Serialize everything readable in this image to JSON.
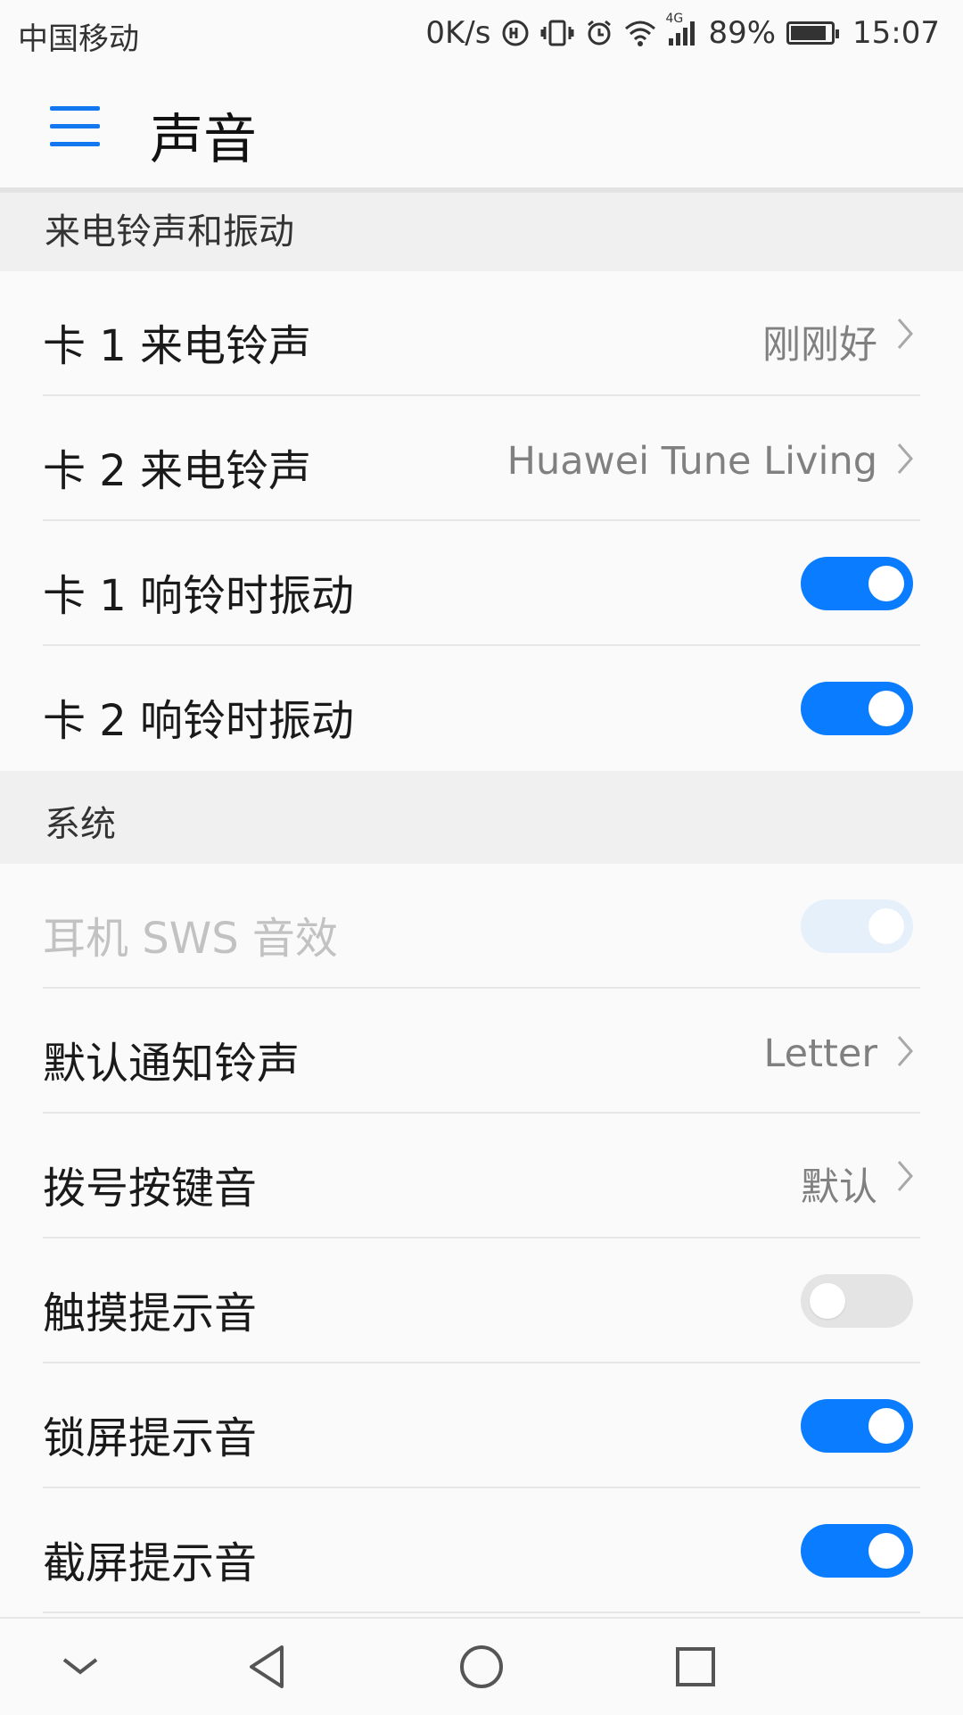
{
  "status_bar": {
    "carrier": "中国移动",
    "speed": "0K/s",
    "network": "4G",
    "battery_percent": "89%",
    "battery_level": 0.89,
    "time": "15:07",
    "icons": [
      "hd-call-icon",
      "vibrate-icon",
      "alarm-icon",
      "wifi-icon",
      "signal-icon",
      "battery-icon"
    ]
  },
  "app_bar": {
    "menu_icon": "menu-icon",
    "title": "声音"
  },
  "sections": {
    "incoming": {
      "title": "来电铃声和振动",
      "rows": [
        {
          "label": "卡 1 来电铃声",
          "value": "刚刚好",
          "type": "link"
        },
        {
          "label": "卡 2 来电铃声",
          "value": "Huawei Tune Living",
          "type": "link"
        },
        {
          "label": "卡 1 响铃时振动",
          "type": "toggle",
          "state": "on"
        },
        {
          "label": "卡 2 响铃时振动",
          "type": "toggle",
          "state": "on"
        }
      ]
    },
    "system": {
      "title": "系统",
      "rows": [
        {
          "label": "耳机 SWS 音效",
          "type": "toggle",
          "state": "on",
          "disabled": true
        },
        {
          "label": "默认通知铃声",
          "value": "Letter",
          "type": "link"
        },
        {
          "label": "拨号按键音",
          "value": "默认",
          "type": "link"
        },
        {
          "label": "触摸提示音",
          "type": "toggle",
          "state": "off"
        },
        {
          "label": "锁屏提示音",
          "type": "toggle",
          "state": "on"
        },
        {
          "label": "截屏提示音",
          "type": "toggle",
          "state": "on"
        }
      ]
    }
  },
  "nav_bar": {
    "buttons": [
      "hide-icon",
      "back-icon",
      "home-icon",
      "recents-icon"
    ]
  },
  "colors": {
    "accent": "#0a7cff",
    "toggle_off": "#e4e4e4",
    "toggle_disabled": "#e6f0fb",
    "secondary_text": "#808080"
  }
}
